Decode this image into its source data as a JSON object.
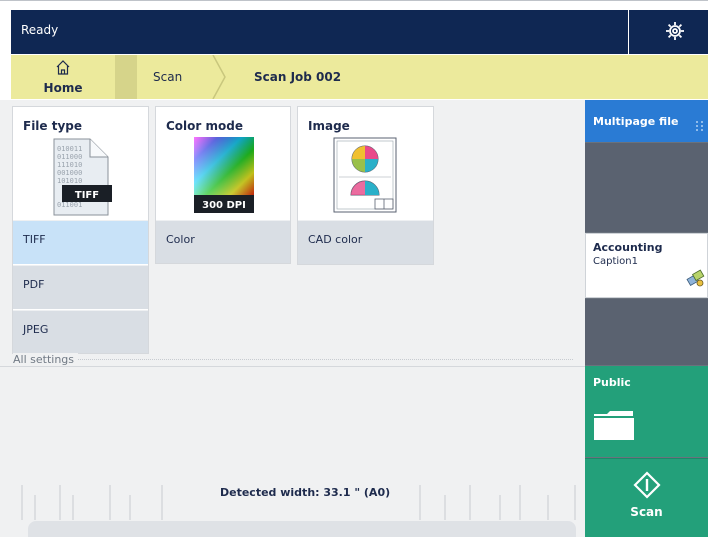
{
  "topbar": {
    "status": "Ready",
    "settings_icon": "gear-icon"
  },
  "breadcrumb": {
    "home_label": "Home",
    "items": [
      "Scan",
      "Scan Job 002"
    ]
  },
  "tiles": {
    "file_type": {
      "title": "File type",
      "badge": "TIFF",
      "options": [
        "TIFF",
        "PDF",
        "JPEG"
      ],
      "selected": "TIFF"
    },
    "color_mode": {
      "title": "Color mode",
      "badge": "300 DPI",
      "value": "Color"
    },
    "image": {
      "title": "Image",
      "value": "CAD color"
    }
  },
  "all_settings_label": "All settings",
  "detected_width": "Detected width: 33.1 \" (A0)",
  "side": {
    "multipage": "Multipage file",
    "destination": {
      "title": "Accounting",
      "caption": "Caption1"
    },
    "public": "Public",
    "scan": "Scan"
  },
  "colors": {
    "navy": "#0f2753",
    "crumb": "#ecea9c",
    "blue": "#2a7bd4",
    "green": "#23a07a",
    "selected": "#c8e2f8"
  }
}
